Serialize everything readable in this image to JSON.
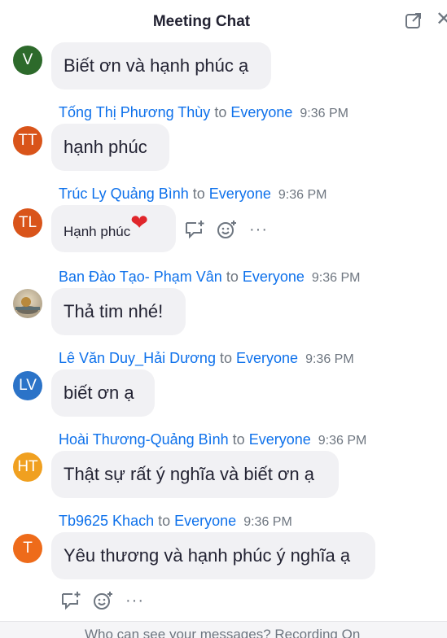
{
  "header": {
    "title": "Meeting Chat"
  },
  "messages": [
    {
      "sender": "",
      "to": "",
      "recipient": "",
      "time": "",
      "initials": "V",
      "color": "#2d6a2b",
      "text": "Biết ơn và hạnh phúc ạ"
    },
    {
      "sender": "Tống Thị Phương Thùy",
      "to": "to",
      "recipient": "Everyone",
      "time": "9:36 PM",
      "initials": "TT",
      "color": "#d9541a",
      "text": "hạnh phúc"
    },
    {
      "sender": "Trúc Ly Quảng Bình",
      "to": "to",
      "recipient": "Everyone",
      "time": "9:36 PM",
      "initials": "TL",
      "color": "#d9541a",
      "text": "Hạnh phúc",
      "emoji": "❤"
    },
    {
      "sender": "Ban Đào Tạo- Phạm Vân",
      "to": "to",
      "recipient": "Everyone",
      "time": "9:36 PM",
      "initials": "",
      "color": "#c8b79a",
      "text": "Thả tim nhé!"
    },
    {
      "sender": "Lê Văn Duy_Hải Dương",
      "to": "to",
      "recipient": "Everyone",
      "time": "9:36 PM",
      "initials": "LV",
      "color": "#2b73c8",
      "text": "biết ơn ạ"
    },
    {
      "sender": "Hoài Thương-Quảng Bình",
      "to": "to",
      "recipient": "Everyone",
      "time": "9:36 PM",
      "initials": "HT",
      "color": "#f0a020",
      "text": "Thật sự rất ý nghĩa và biết ơn ạ"
    },
    {
      "sender": "Tb9625 Khach",
      "to": "to",
      "recipient": "Everyone",
      "time": "9:36 PM",
      "initials": "T",
      "color": "#ee6b1a",
      "text": "Yêu thương và hạnh phúc ý nghĩa ạ"
    }
  ],
  "actions": {
    "more": "···"
  },
  "footer": {
    "text": "Who can see your messages? Recording On"
  }
}
